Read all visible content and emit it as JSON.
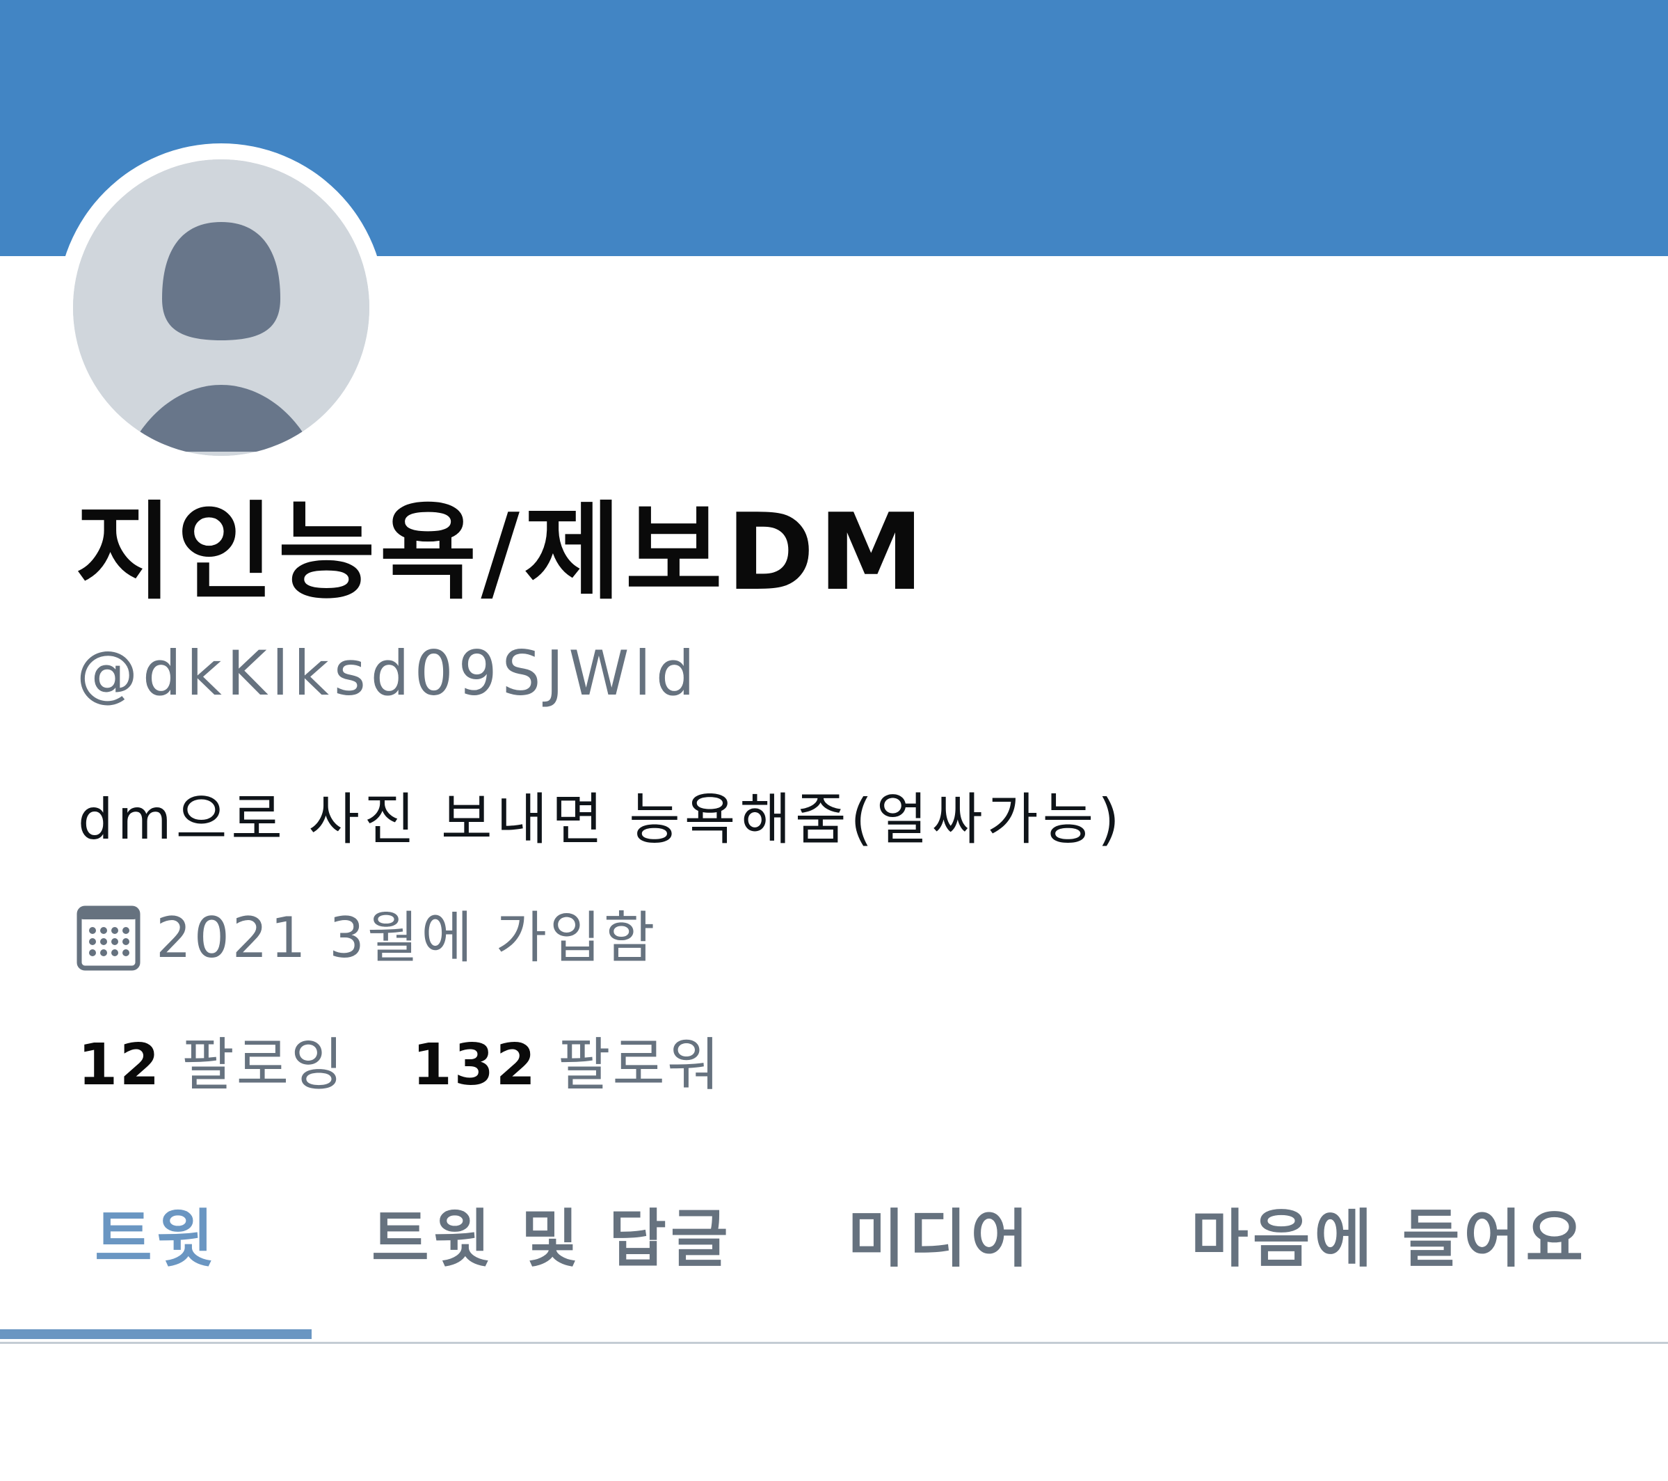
{
  "profile": {
    "display_name": "지인능욕/제보DM",
    "handle": "@dkKlksd09SJWld",
    "bio": "dm으로 사진 보내면 능욕해줌(얼싸가능)",
    "joined": "2021 3월에 가입함",
    "following_count": "12",
    "following_label": "팔로잉",
    "followers_count": "132",
    "followers_label": "팔로워"
  },
  "tabs": [
    {
      "label": "트윗",
      "active": true
    },
    {
      "label": "트윗 및 답글",
      "active": false
    },
    {
      "label": "미디어",
      "active": false
    },
    {
      "label": "마음에 들어요",
      "active": false
    }
  ],
  "icons": {
    "calendar": "calendar-icon",
    "avatar": "default-avatar-icon"
  },
  "colors": {
    "banner": "#4285c4",
    "avatar_bg": "#d0d6dc",
    "avatar_figure": "#68768a",
    "muted_text": "#66727f",
    "active_tab": "#6a96c2"
  }
}
